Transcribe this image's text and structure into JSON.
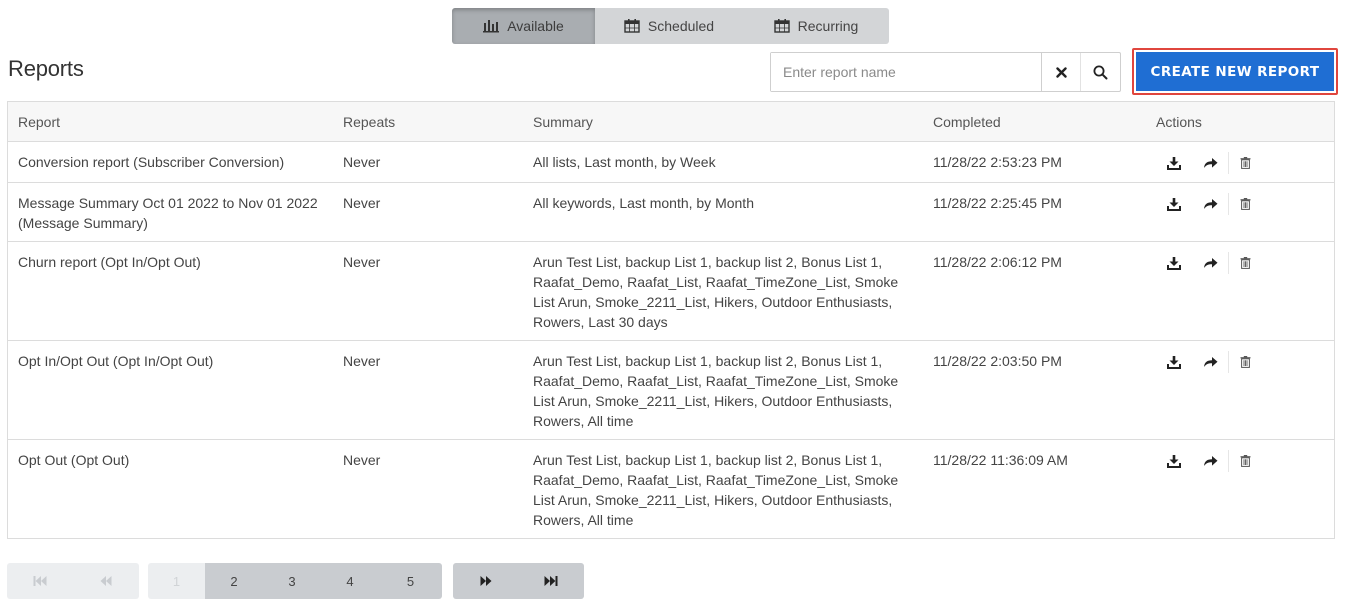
{
  "tabs": [
    {
      "label": "Available",
      "icon": "bar-chart-icon",
      "active": true
    },
    {
      "label": "Scheduled",
      "icon": "calendar-icon",
      "active": false
    },
    {
      "label": "Recurring",
      "icon": "calendar-icon",
      "active": false
    }
  ],
  "header": {
    "title": "Reports",
    "search_placeholder": "Enter report name",
    "create_label": "CREATE NEW REPORT"
  },
  "colors": {
    "accent": "#1f6ed3",
    "highlight_border": "#e0463e",
    "tab_active": "#a9adb1",
    "tab_inactive": "#d3d5d7"
  },
  "table": {
    "columns": [
      "Report",
      "Repeats",
      "Summary",
      "Completed",
      "Actions"
    ],
    "rows": [
      {
        "report": "Conversion report (Subscriber Conversion)",
        "repeats": "Never",
        "summary": "All lists, Last month, by Week",
        "completed": "11/28/22 2:53:23 PM"
      },
      {
        "report": "Message Summary Oct 01 2022 to Nov 01 2022 (Message Summary)",
        "repeats": "Never",
        "summary": "All keywords, Last month, by Month",
        "completed": "11/28/22 2:25:45 PM"
      },
      {
        "report": "Churn report (Opt In/Opt Out)",
        "repeats": "Never",
        "summary": "Arun Test List, backup List 1, backup list 2, Bonus List 1, Raafat_Demo, Raafat_List, Raafat_TimeZone_List, Smoke List Arun, Smoke_2211_List, Hikers, Outdoor Enthusiasts, Rowers, Last 30 days",
        "completed": "11/28/22 2:06:12 PM"
      },
      {
        "report": "Opt In/Opt Out (Opt In/Opt Out)",
        "repeats": "Never",
        "summary": "Arun Test List, backup List 1, backup list 2, Bonus List 1, Raafat_Demo, Raafat_List, Raafat_TimeZone_List, Smoke List Arun, Smoke_2211_List, Hikers, Outdoor Enthusiasts, Rowers, All time",
        "completed": "11/28/22 2:03:50 PM"
      },
      {
        "report": "Opt Out (Opt Out)",
        "repeats": "Never",
        "summary": "Arun Test List, backup List 1, backup list 2, Bonus List 1, Raafat_Demo, Raafat_List, Raafat_TimeZone_List, Smoke List Arun, Smoke_2211_List, Hikers, Outdoor Enthusiasts, Rowers, All time",
        "completed": "11/28/22 11:36:09 AM"
      }
    ]
  },
  "pagination": {
    "pages": [
      "1",
      "2",
      "3",
      "4",
      "5"
    ],
    "current_page": "1"
  }
}
